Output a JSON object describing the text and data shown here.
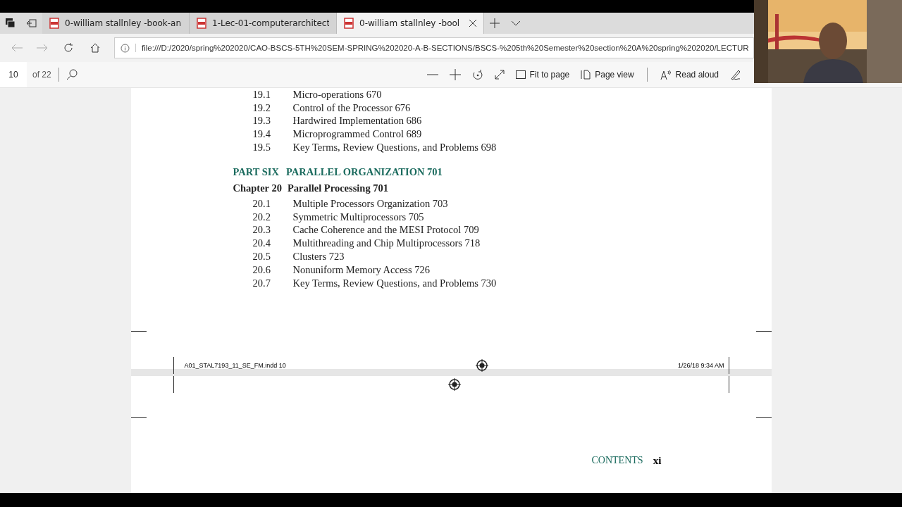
{
  "tabs": [
    {
      "title": "0-william stallnley -book-an",
      "selected": false
    },
    {
      "title": "1-Lec-01-computerarchitect",
      "selected": false
    },
    {
      "title": "0-william stallnley -bool",
      "selected": true
    }
  ],
  "address": {
    "url": "file:///D:/2020/spring%202020/CAO-BSCS-5TH%20SEM-SPRING%202020-A-B-SECTIONS/BSCS-%205th%20Semester%20section%20A%20spring%202020/LECTUR"
  },
  "pdf_toolbar": {
    "page": "10",
    "of": "of 22",
    "fit": "Fit to page",
    "view": "Page view",
    "read": "Read aloud"
  },
  "page1": {
    "sections_a": [
      {
        "num": "19.1",
        "title": "Micro-operations 670"
      },
      {
        "num": "19.2",
        "title": "Control of the Processor 676"
      },
      {
        "num": "19.3",
        "title": "Hardwired Implementation 686"
      },
      {
        "num": "19.4",
        "title": "Microprogrammed Control 689"
      },
      {
        "num": "19.5",
        "title": "Key Terms, Review Questions, and Problems 698"
      }
    ],
    "part": {
      "label": "PART SIX",
      "title": "PARALLEL ORGANIZATION 701"
    },
    "chapter": {
      "label": "Chapter 20",
      "title": "Parallel Processing 701"
    },
    "sections_b": [
      {
        "num": "20.1",
        "title": "Multiple Processors Organization 703"
      },
      {
        "num": "20.2",
        "title": "Symmetric Multiprocessors 705"
      },
      {
        "num": "20.3",
        "title": "Cache Coherence and the MESI Protocol 709"
      },
      {
        "num": "20.4",
        "title": "Multithreading and Chip Multiprocessors 718"
      },
      {
        "num": "20.5",
        "title": "Clusters 723"
      },
      {
        "num": "20.6",
        "title": "Nonuniform Memory Access 726"
      },
      {
        "num": "20.7",
        "title": "Key Terms, Review Questions, and Problems 730"
      }
    ],
    "slug_file": "A01_STAL7193_11_SE_FM.indd  10",
    "slug_date": "1/26/18   9:34 AM"
  },
  "page2": {
    "header": "CONTENTS",
    "page_num": "xi"
  }
}
